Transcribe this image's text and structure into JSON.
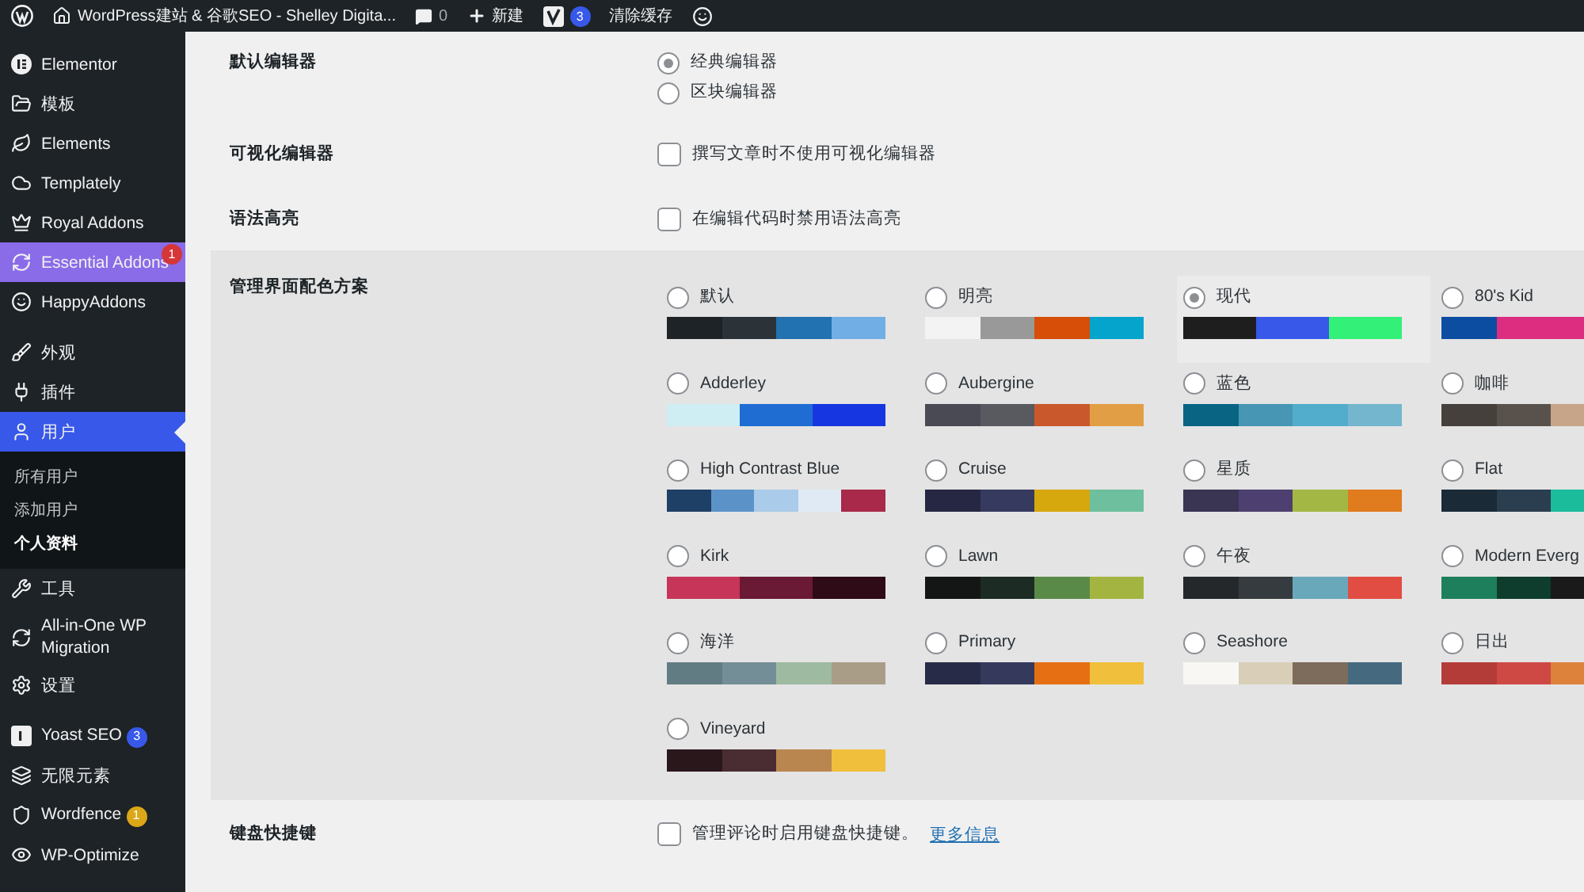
{
  "admin_bar": {
    "site_title": "WordPress建站 & 谷歌SEO - Shelley Digita...",
    "comments": "0",
    "new_label": "新建",
    "yoast_badge": "3",
    "clear_cache": "清除缓存"
  },
  "sidebar": {
    "groups": [
      [
        {
          "label": "Elementor",
          "selected": false,
          "highlighted": false
        },
        {
          "label": "模板",
          "selected": false,
          "highlighted": false
        },
        {
          "label": "Elements",
          "selected": false,
          "highlighted": false
        },
        {
          "label": "Templately",
          "selected": false,
          "highlighted": false
        },
        {
          "label": "Royal Addons",
          "selected": false,
          "highlighted": false
        },
        {
          "label": "Essential Addons",
          "selected": false,
          "highlighted": true,
          "badge": {
            "text": "1",
            "color": "#d63638"
          }
        },
        {
          "label": "HappyAddons",
          "selected": false,
          "highlighted": false
        }
      ],
      [
        {
          "label": "外观",
          "selected": false,
          "highlighted": false
        },
        {
          "label": "插件",
          "selected": false,
          "highlighted": false
        },
        {
          "label": "用户",
          "selected": true,
          "highlighted": false,
          "children": [
            {
              "label": "所有用户",
              "selected": false
            },
            {
              "label": "添加用户",
              "selected": false
            },
            {
              "label": "个人资料",
              "selected": true
            }
          ]
        },
        {
          "label": "工具",
          "selected": false,
          "highlighted": false
        },
        {
          "label": "All-in-One WP Migration",
          "selected": false,
          "highlighted": false
        },
        {
          "label": "设置",
          "selected": false,
          "highlighted": false
        }
      ],
      [
        {
          "label": "Yoast SEO",
          "selected": false,
          "highlighted": false,
          "badge": {
            "text": "3",
            "color": "#3858e9"
          }
        },
        {
          "label": "无限元素",
          "selected": false,
          "highlighted": false
        },
        {
          "label": "Wordfence",
          "selected": false,
          "highlighted": false,
          "badge": {
            "text": "1",
            "color": "#dba617"
          }
        },
        {
          "label": "WP-Optimize",
          "selected": false,
          "highlighted": false
        }
      ]
    ]
  },
  "settings": [
    {
      "label": "默认编辑器",
      "kind": "radio",
      "options": [
        {
          "label": "经典编辑器",
          "selected": true
        },
        {
          "label": "区块编辑器",
          "selected": false
        }
      ]
    },
    {
      "label": "可视化编辑器",
      "kind": "checkbox",
      "options": [
        {
          "label": "撰写文章时不使用可视化编辑器",
          "checked": false
        }
      ]
    },
    {
      "label": "语法高亮",
      "kind": "checkbox",
      "options": [
        {
          "label": "在编辑代码时禁用语法高亮",
          "checked": false
        }
      ]
    }
  ],
  "color_scheme": {
    "label": "管理界面配色方案",
    "schemes": [
      {
        "name": "默认",
        "selected": false,
        "kind": "full",
        "swatches": [
          {
            "color": "#1d2327"
          },
          {
            "color": "#2c3338"
          },
          {
            "color": "#2271b1"
          },
          {
            "color": "#72aee6"
          }
        ]
      },
      {
        "name": "明亮",
        "selected": false,
        "kind": "full",
        "swatches": [
          {
            "color": "#f3f3f3"
          },
          {
            "color": "#999999"
          },
          {
            "color": "#d64e07"
          },
          {
            "color": "#04a4cc"
          }
        ]
      },
      {
        "name": "现代",
        "selected": true,
        "kind": "full",
        "swatches": [
          {
            "color": "#1e1e1e"
          },
          {
            "color": "#3858e9"
          },
          {
            "color": "#33f078"
          }
        ]
      },
      {
        "name": "80's Kid",
        "selected": false,
        "kind": "cut",
        "swatches": [
          {
            "color": "#0c4da2"
          },
          {
            "color": "#dd2d80"
          }
        ]
      },
      {
        "name": "Adderley",
        "selected": false,
        "kind": "full",
        "swatches": [
          {
            "color": "#cfeef3"
          },
          {
            "color": "#1f6cd3"
          },
          {
            "color": "#1536e0"
          }
        ]
      },
      {
        "name": "Aubergine",
        "selected": false,
        "kind": "full",
        "swatches": [
          {
            "color": "#4a4a54"
          },
          {
            "color": "#595960"
          },
          {
            "color": "#c9592c"
          },
          {
            "color": "#e29e44"
          }
        ]
      },
      {
        "name": "蓝色",
        "selected": false,
        "kind": "full",
        "swatches": [
          {
            "color": "#096484"
          },
          {
            "color": "#4796b3"
          },
          {
            "color": "#52accc"
          },
          {
            "color": "#74b6ce"
          }
        ]
      },
      {
        "name": "咖啡",
        "selected": false,
        "kind": "cut",
        "swatches": [
          {
            "color": "#46403c"
          },
          {
            "color": "#59524c"
          },
          {
            "color": "#c7a589"
          }
        ]
      },
      {
        "name": "High Contrast Blue",
        "selected": false,
        "kind": "full",
        "swatches": [
          {
            "color": "#1e3f66"
          },
          {
            "color": "#5b93c9"
          },
          {
            "color": "#aacbe9"
          },
          {
            "color": "#e0eaf5"
          },
          {
            "color": "#a8294a"
          }
        ]
      },
      {
        "name": "Cruise",
        "selected": false,
        "kind": "full",
        "swatches": [
          {
            "color": "#262742"
          },
          {
            "color": "#353a5e"
          },
          {
            "color": "#d7a70e"
          },
          {
            "color": "#6dbf9d"
          }
        ]
      },
      {
        "name": "星质",
        "selected": false,
        "kind": "full",
        "swatches": [
          {
            "color": "#393553"
          },
          {
            "color": "#4d3f6f"
          },
          {
            "color": "#a3b844"
          },
          {
            "color": "#e07b1e"
          }
        ]
      },
      {
        "name": "Flat",
        "selected": false,
        "kind": "cut",
        "swatches": [
          {
            "color": "#1a2a37"
          },
          {
            "color": "#2b3e50"
          },
          {
            "color": "#1abc9c"
          }
        ]
      },
      {
        "name": "Kirk",
        "selected": false,
        "kind": "full",
        "swatches": [
          {
            "color": "#c73559"
          },
          {
            "color": "#6a1a34"
          },
          {
            "color": "#2e0b17"
          }
        ]
      },
      {
        "name": "Lawn",
        "selected": false,
        "kind": "full",
        "swatches": [
          {
            "color": "#141616"
          },
          {
            "color": "#1c2b23"
          },
          {
            "color": "#5a8a48"
          },
          {
            "color": "#a3b540"
          }
        ]
      },
      {
        "name": "午夜",
        "selected": false,
        "kind": "full",
        "swatches": [
          {
            "color": "#25282b"
          },
          {
            "color": "#363b3f"
          },
          {
            "color": "#69a8bb"
          },
          {
            "color": "#e14d43"
          }
        ]
      },
      {
        "name": "Modern Everg",
        "selected": false,
        "kind": "cut",
        "swatches": [
          {
            "color": "#1e7f5c"
          },
          {
            "color": "#0e3d2d"
          },
          {
            "color": "#1a1a1a"
          }
        ]
      },
      {
        "name": "海洋",
        "selected": false,
        "kind": "full",
        "swatches": [
          {
            "color": "#627c83"
          },
          {
            "color": "#738e96"
          },
          {
            "color": "#9ebaa0"
          },
          {
            "color": "#aa9d88"
          }
        ]
      },
      {
        "name": "Primary",
        "selected": false,
        "kind": "full",
        "swatches": [
          {
            "color": "#282b48"
          },
          {
            "color": "#35395c"
          },
          {
            "color": "#e66f14"
          },
          {
            "color": "#f0bf3c"
          }
        ]
      },
      {
        "name": "Seashore",
        "selected": false,
        "kind": "full",
        "swatches": [
          {
            "color": "#f8f7f3"
          },
          {
            "color": "#d9cfb8"
          },
          {
            "color": "#7d6b5c"
          },
          {
            "color": "#456a7f"
          }
        ]
      },
      {
        "name": "日出",
        "selected": false,
        "kind": "cut",
        "swatches": [
          {
            "color": "#b43c38"
          },
          {
            "color": "#cf4944"
          },
          {
            "color": "#dd823b"
          }
        ]
      },
      {
        "name": "Vineyard",
        "selected": false,
        "kind": "full",
        "swatches": [
          {
            "color": "#2a171c"
          },
          {
            "color": "#4a2c33"
          },
          {
            "color": "#b98650"
          },
          {
            "color": "#f0bf3c"
          }
        ]
      }
    ]
  },
  "keyboard": {
    "label": "键盘快捷键",
    "option": "管理评论时启用键盘快捷键。",
    "checked": false,
    "link": "更多信息"
  }
}
